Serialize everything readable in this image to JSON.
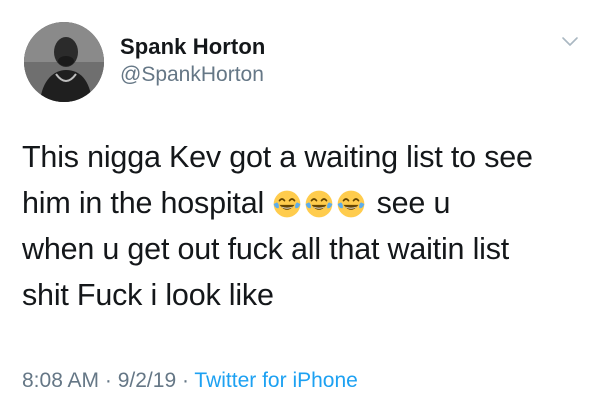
{
  "tweet": {
    "author": {
      "name": "Spank Horton",
      "handle": "@SpankHorton"
    },
    "text": {
      "line1": "This nigga Kev got a waiting list to see",
      "line2_start": "him in the hospital",
      "line2_end": " see u",
      "line3": "when u get out fuck all that waitin list",
      "line4": "shit Fuck i look like"
    },
    "emojis": [
      "face-with-tears-of-joy-icon",
      "face-with-tears-of-joy-icon",
      "face-with-tears-of-joy-icon"
    ],
    "meta": {
      "time": "8:08 AM",
      "separator1": " · ",
      "date": "9/2/19",
      "separator2": " · ",
      "source": "Twitter for iPhone"
    }
  },
  "colors": {
    "text": "#14171a",
    "secondary": "#657786",
    "link": "#1da1f2",
    "emoji": "#ffcc4d",
    "tears": "#5dadec"
  }
}
